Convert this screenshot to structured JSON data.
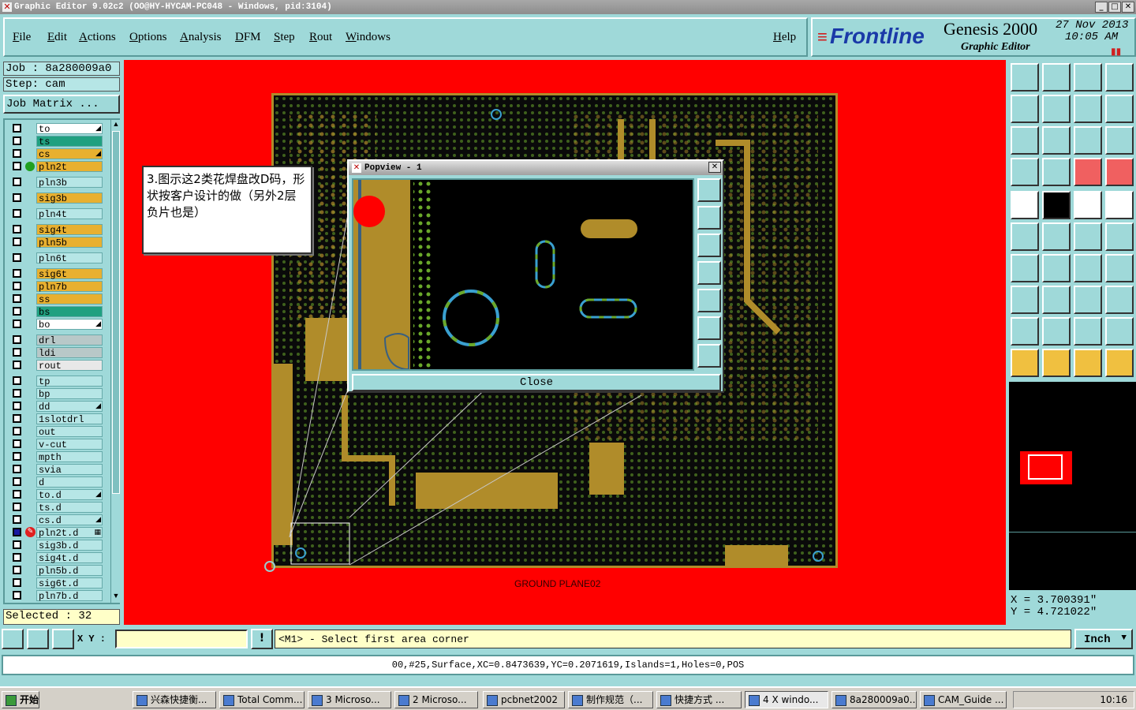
{
  "window": {
    "title": "Graphic Editor 9.02c2 (OO@HY-HYCAM-PC048 - Windows, pid:3104)"
  },
  "menu": {
    "items": [
      "File",
      "Edit",
      "Actions",
      "Options",
      "Analysis",
      "DFM",
      "Step",
      "Rout",
      "Windows"
    ],
    "help": "Help"
  },
  "brand": {
    "logo": "Frontline",
    "product": "Genesis 2000",
    "subtitle": "Graphic Editor",
    "date": "27 Nov 2013",
    "time": "10:05 AM"
  },
  "job": {
    "job_label": "Job : 8a280009a0",
    "step_label": "Step: cam",
    "matrix_button": "Job Matrix ..."
  },
  "layers": [
    {
      "name": "to",
      "color": "#ffffff",
      "mark": "◢"
    },
    {
      "name": "ts",
      "color": "#20a080",
      "mark": ""
    },
    {
      "name": "cs",
      "color": "#e8b030",
      "mark": "◢"
    },
    {
      "name": "pln2t",
      "color": "#e8b030",
      "mark": ""
    },
    {
      "name": "pln3b",
      "color": "#b6e6e6",
      "mark": ""
    },
    {
      "name": "sig3b",
      "color": "#e8b030",
      "mark": ""
    },
    {
      "name": "pln4t",
      "color": "#b6e6e6",
      "mark": ""
    },
    {
      "name": "sig4t",
      "color": "#e8b030",
      "mark": ""
    },
    {
      "name": "pln5b",
      "color": "#e8b030",
      "mark": ""
    },
    {
      "name": "pln6t",
      "color": "#b6e6e6",
      "mark": ""
    },
    {
      "name": "sig6t",
      "color": "#e8b030",
      "mark": ""
    },
    {
      "name": "pln7b",
      "color": "#e8b030",
      "mark": ""
    },
    {
      "name": "ss",
      "color": "#e8b030",
      "mark": ""
    },
    {
      "name": "bs",
      "color": "#20a080",
      "mark": ""
    },
    {
      "name": "bo",
      "color": "#ffffff",
      "mark": "◢"
    },
    {
      "name": "drl",
      "color": "#b8c8c8",
      "mark": ""
    },
    {
      "name": "ldi",
      "color": "#b8c8c8",
      "mark": ""
    },
    {
      "name": "rout",
      "color": "#e8e8e8",
      "mark": ""
    },
    {
      "name": "tp",
      "color": "#b6e6e6",
      "mark": ""
    },
    {
      "name": "bp",
      "color": "#b6e6e6",
      "mark": ""
    },
    {
      "name": "dd",
      "color": "#b6e6e6",
      "mark": "◢"
    },
    {
      "name": "1slotdrl",
      "color": "#b6e6e6",
      "mark": ""
    },
    {
      "name": "out",
      "color": "#b6e6e6",
      "mark": ""
    },
    {
      "name": "v-cut",
      "color": "#b6e6e6",
      "mark": ""
    },
    {
      "name": "mpth",
      "color": "#b6e6e6",
      "mark": ""
    },
    {
      "name": "svia",
      "color": "#b6e6e6",
      "mark": ""
    },
    {
      "name": "d",
      "color": "#b6e6e6",
      "mark": ""
    },
    {
      "name": "to.d",
      "color": "#b6e6e6",
      "mark": "◢"
    },
    {
      "name": "ts.d",
      "color": "#b6e6e6",
      "mark": ""
    },
    {
      "name": "cs.d",
      "color": "#b6e6e6",
      "mark": "◢"
    },
    {
      "name": "pln2t.d",
      "color": "#b6e6e6",
      "mark": "▦"
    },
    {
      "name": "sig3b.d",
      "color": "#b6e6e6",
      "mark": ""
    },
    {
      "name": "sig4t.d",
      "color": "#b6e6e6",
      "mark": ""
    },
    {
      "name": "pln5b.d",
      "color": "#b6e6e6",
      "mark": ""
    },
    {
      "name": "sig6t.d",
      "color": "#b6e6e6",
      "mark": ""
    },
    {
      "name": "pln7b.d",
      "color": "#b6e6e6",
      "mark": ""
    }
  ],
  "selected": "Selected : 32",
  "callout": {
    "text": "3.图示这2类花焊盘改D码，形状按客户设计的做（另外2层负片也是）"
  },
  "board": {
    "label": "GROUND PLANE02"
  },
  "popview": {
    "title": "Popview - 1",
    "close": "Close"
  },
  "coords": {
    "x": "X = 3.700391\"",
    "y": "Y = 4.721022\""
  },
  "cmd": {
    "xy_label": "X Y :",
    "prompt": "<M1> - Select first area corner",
    "unit": "Inch"
  },
  "status": "00,#25,Surface,XC=0.8473639,YC=0.2071619,Islands=1,Holes=0,POS",
  "taskbar": {
    "start": "开始",
    "tasks": [
      "兴森快捷衡...",
      "Total Comm...",
      "3 Microso...",
      "2 Microso...",
      "pcbnet2002",
      "制作规范（...",
      "快捷方式 ...",
      "4 X windo...",
      "8a280009a0...",
      "CAM_Guide ..."
    ],
    "clock": "10:16"
  }
}
